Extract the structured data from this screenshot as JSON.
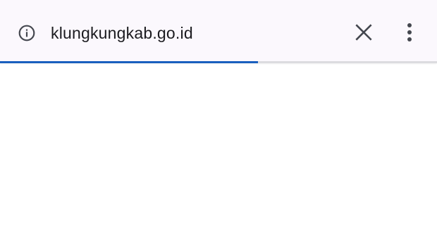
{
  "toolbar": {
    "url": "klungkungkab.go.id",
    "icons": {
      "info": "info-icon",
      "close": "close-icon",
      "menu": "more-vert-icon"
    },
    "colors": {
      "background": "#fbf8fd",
      "icon": "#44474f",
      "text": "#1b1b1f"
    }
  },
  "page_load": {
    "progress": 0.59,
    "bar_color": "#1a5fbf",
    "track_color": "#dcdce0"
  }
}
